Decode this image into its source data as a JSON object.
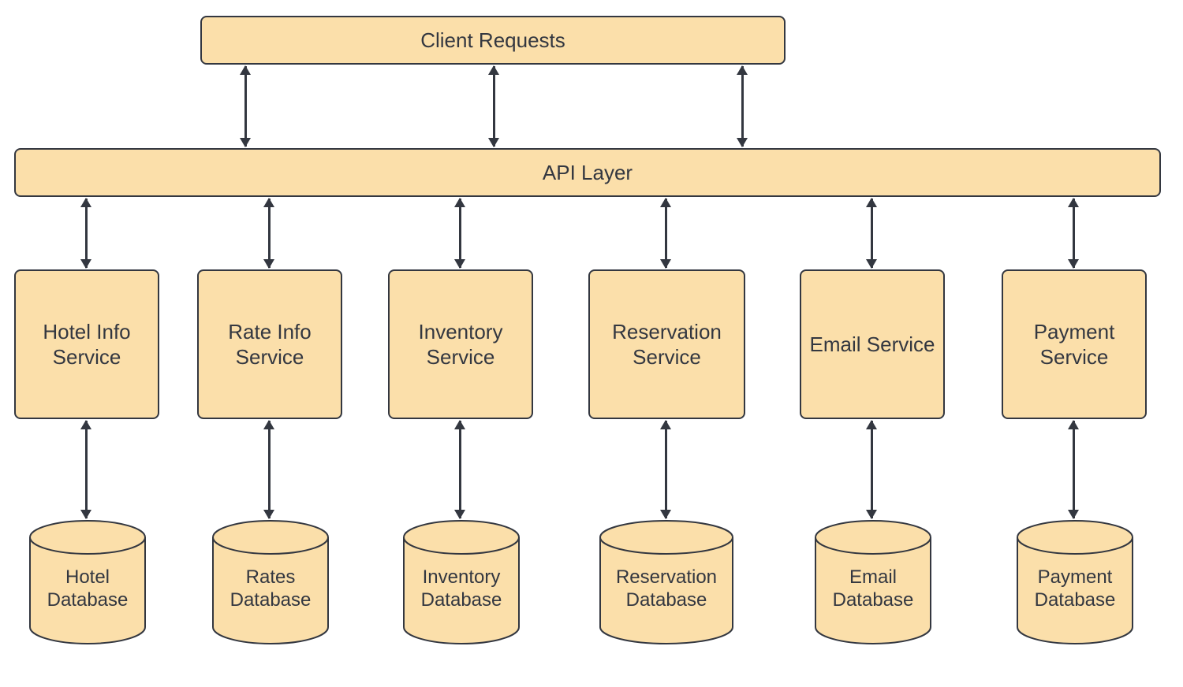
{
  "colors": {
    "box_fill": "#fbdfaa",
    "stroke": "#333740"
  },
  "client": {
    "label": "Client Requests"
  },
  "api": {
    "label": "API Layer"
  },
  "services": [
    {
      "name": "Hotel Info Service",
      "db": "Hotel Database"
    },
    {
      "name": "Rate Info Service",
      "db": "Rates Database"
    },
    {
      "name": "Inventory Service",
      "db": "Inventory Database"
    },
    {
      "name": "Reservation Service",
      "db": "Reservation Database"
    },
    {
      "name": "Email Service",
      "db": "Email Database"
    },
    {
      "name": "Payment Service",
      "db": "Payment Database"
    }
  ]
}
